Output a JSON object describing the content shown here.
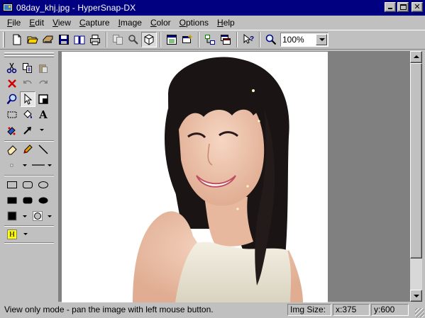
{
  "window": {
    "title": "08day_khj.jpg - HyperSnap-DX",
    "app_icon": "hypersnap-app-icon",
    "buttons": [
      "minimize-icon",
      "maximize-icon",
      "close-icon"
    ]
  },
  "menu": [
    {
      "label": "File",
      "ul": "F",
      "rest": "ile"
    },
    {
      "label": "Edit",
      "ul": "E",
      "rest": "dit"
    },
    {
      "label": "View",
      "ul": "V",
      "rest": "iew"
    },
    {
      "label": "Capture",
      "ul": "C",
      "rest": "apture"
    },
    {
      "label": "Image",
      "ul": "I",
      "rest": "mage"
    },
    {
      "label": "Color",
      "ul": "C",
      "rest": "olor"
    },
    {
      "label": "Options",
      "ul": "O",
      "rest": "ptions"
    },
    {
      "label": "Help",
      "ul": "H",
      "rest": "elp"
    }
  ],
  "toolbar": {
    "buttons": [
      "new-icon",
      "open-icon",
      "scan-icon",
      "save-icon",
      "book-icon",
      "print-icon",
      "copy-icon",
      "properties-icon",
      "cube-icon",
      "window-list-icon",
      "capture-icon",
      "tree-icon",
      "windows-icon",
      "context-help-icon",
      "zoom-icon"
    ],
    "zoom_value": "100%"
  },
  "palette": {
    "text_tool_glyph": "A",
    "highlight_glyph": "H"
  },
  "status": {
    "message": "View only mode - pan the image with left mouse button.",
    "img_size_label": "Img Size:",
    "width": "x:375",
    "height": "y:600"
  },
  "colors": {
    "title_bar": "#000080",
    "face": "#c0c0c0",
    "workspace": "#808080",
    "highlight_yellow": "#ffff00"
  }
}
